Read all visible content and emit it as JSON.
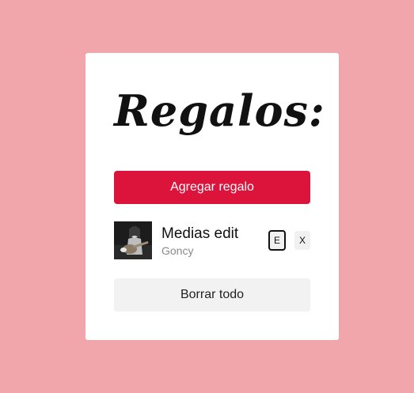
{
  "page": {
    "title": "Regalos:"
  },
  "actions": {
    "add_label": "Agregar regalo",
    "clear_label": "Borrar todo"
  },
  "gifts": [
    {
      "name": "Medias edit",
      "recipient": "Goncy",
      "thumbnail_icon": "guitarist-photo",
      "edit_label": "E",
      "delete_label": "X"
    }
  ],
  "colors": {
    "background": "#f0a6aa",
    "card": "#ffffff",
    "accent": "#dc143c",
    "secondary_button": "#f2f2f2"
  }
}
